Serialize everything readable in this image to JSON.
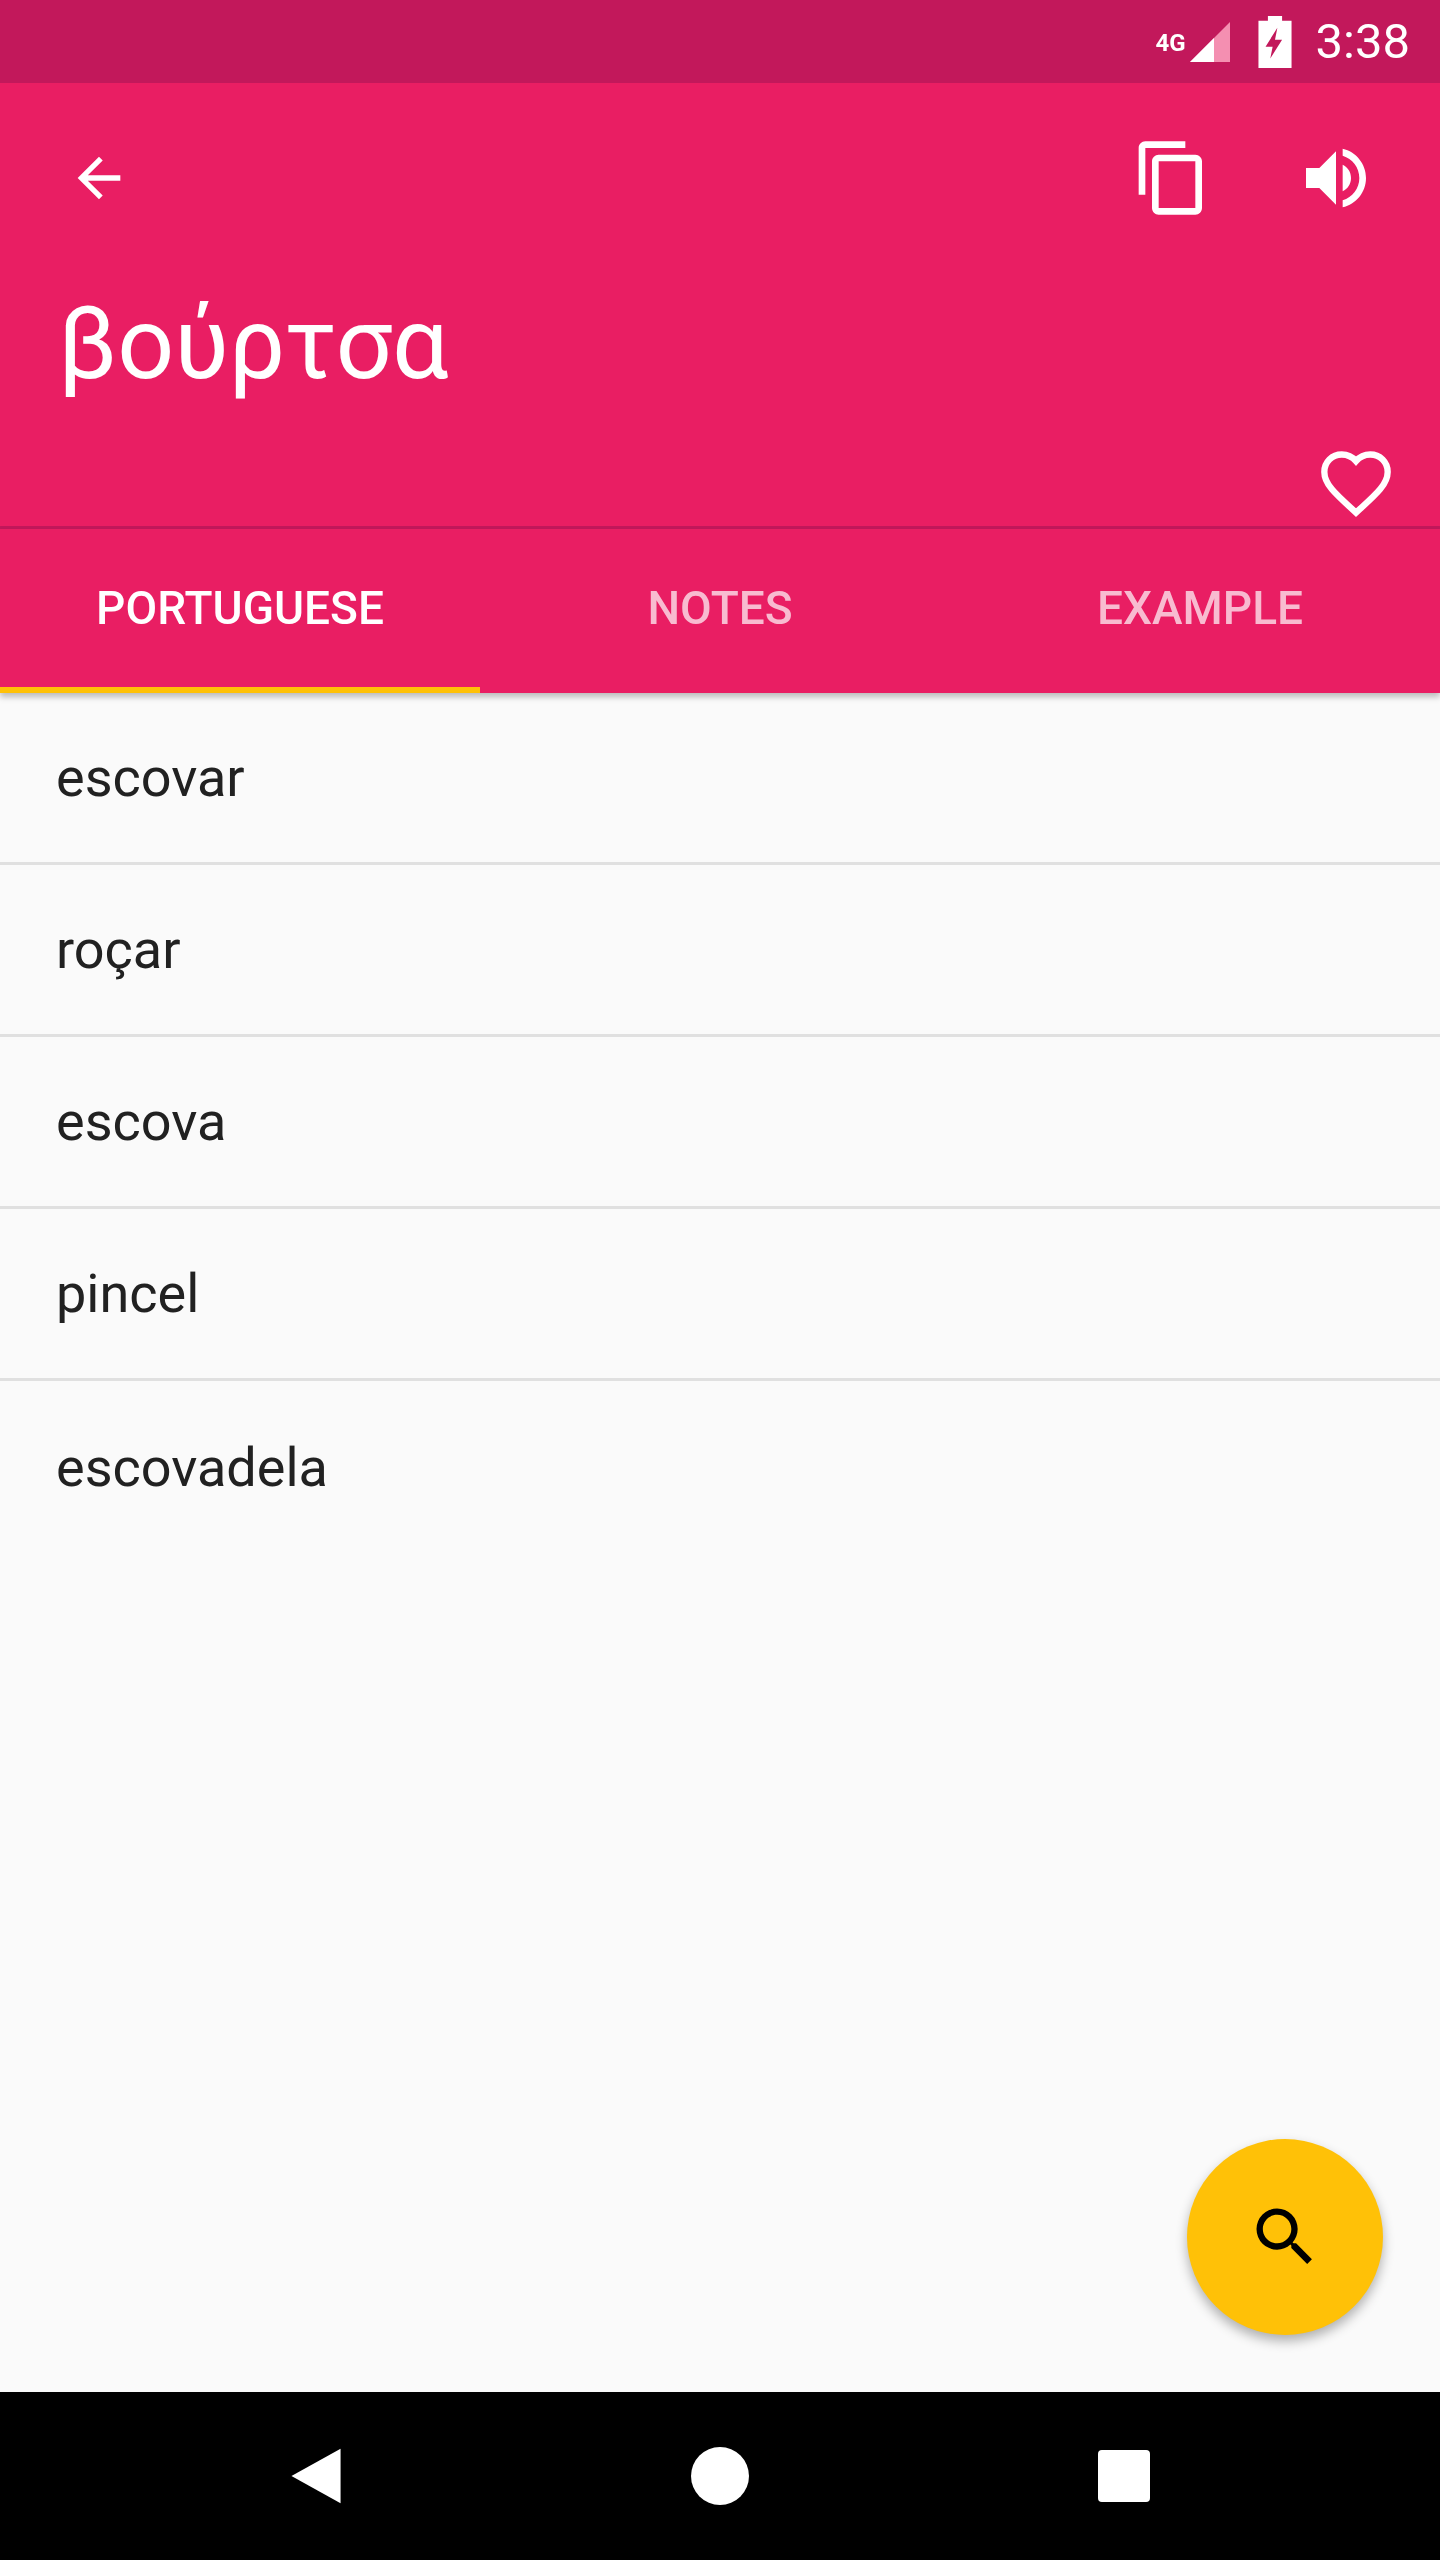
{
  "status_bar": {
    "network": "4G",
    "time": "3:38"
  },
  "toolbar": {
    "title": "βούρτσα",
    "favorite": false
  },
  "tabs": [
    {
      "label": "PORTUGUESE",
      "selected": true
    },
    {
      "label": "NOTES",
      "selected": false
    },
    {
      "label": "EXAMPLE",
      "selected": false
    }
  ],
  "translations": [
    "escovar",
    "roçar",
    "escova",
    "pincel",
    "escovadela"
  ]
}
